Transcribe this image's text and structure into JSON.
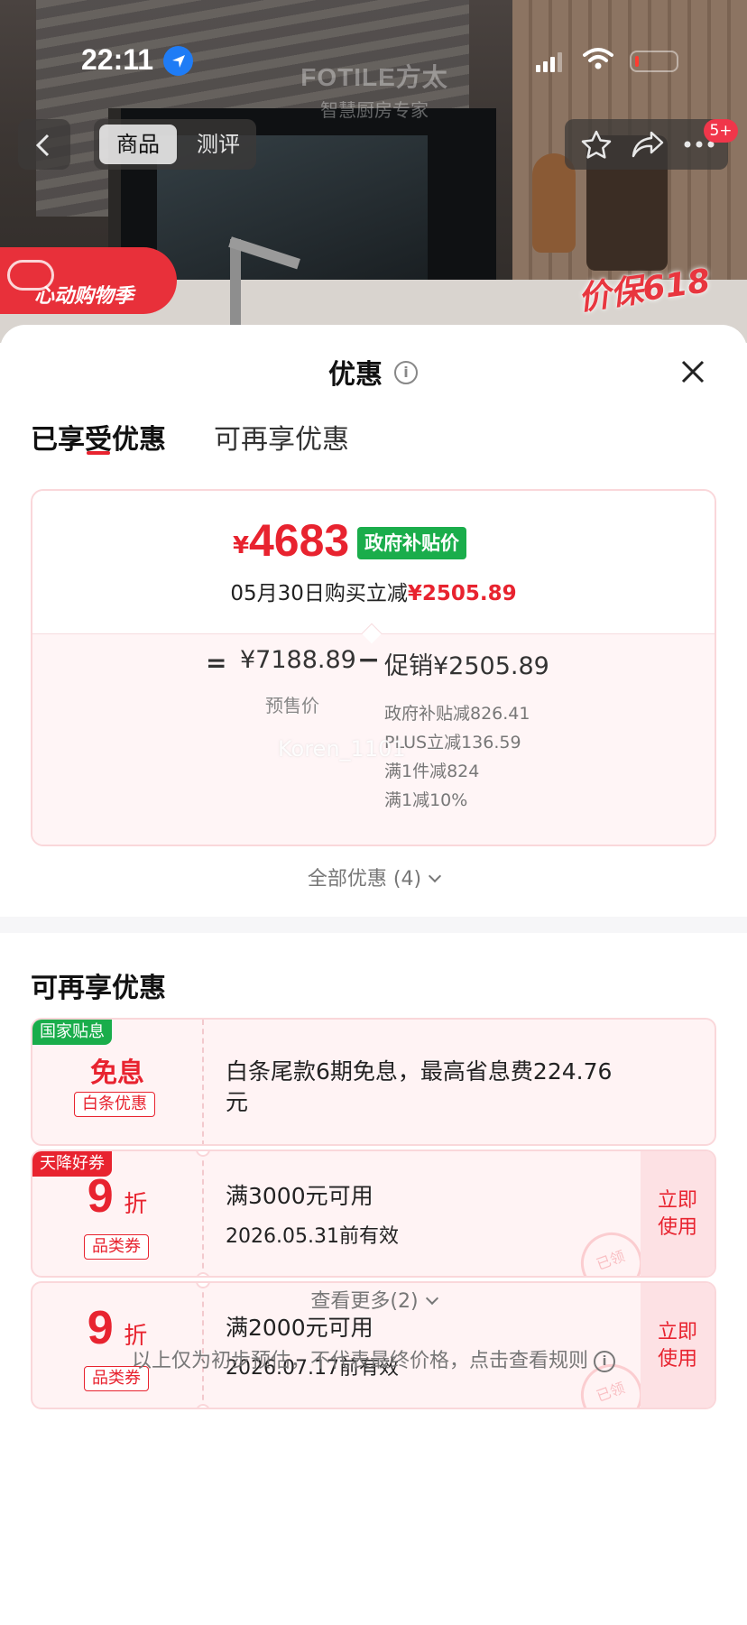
{
  "status_bar": {
    "time": "22:11"
  },
  "hero": {
    "brand_logo": "FOTILE方太",
    "brand_slogan": "智慧厨房专家",
    "tabs": [
      "商品",
      "测评"
    ],
    "badge": "5+",
    "promo_left": "心动购物季",
    "promo_right": "价保618"
  },
  "sheet": {
    "title": "优惠",
    "tabs": {
      "enjoyed": "已享受优惠",
      "more": "可再享优惠"
    },
    "calc": {
      "price_yen": "¥",
      "price_value": "4683",
      "price_tag": "政府补贴价",
      "subtitle_prefix": "05月30日购买立减",
      "subtitle_amount": "¥2505.89",
      "equals": "=",
      "presale_price": "¥7188.89",
      "presale_label": "预售价",
      "minus": "−",
      "promo_total": "促销¥2505.89",
      "promo_items": [
        "政府补贴减826.41",
        "PLUS立减136.59",
        "满1件减824",
        "满1减10%"
      ],
      "watermark": "Koren_1101"
    },
    "all_discounts": "全部优惠 (4)",
    "section2_title": "可再享优惠",
    "coupons": [
      {
        "corner_tag": "国家贴息",
        "corner_color": "#1aad4b",
        "big_text": "免息",
        "tag": "白条优惠",
        "desc1": "白条尾款6期免息，最高省息费224.76",
        "desc2": "元"
      },
      {
        "corner_tag": "天降好券",
        "corner_color": "#e8232f",
        "big_number": "9",
        "big_unit": "折",
        "tag": "品类券",
        "desc1": "满3000元可用",
        "desc2": "2026.05.31前有效",
        "use_label_1": "立即",
        "use_label_2": "使用",
        "stamp": "已领"
      },
      {
        "big_number": "9",
        "big_unit": "折",
        "tag": "品类券",
        "desc1": "满2000元可用",
        "desc2": "2026.07.17前有效",
        "use_label_1": "立即",
        "use_label_2": "使用",
        "stamp": "已领"
      }
    ],
    "see_more": "查看更多(2)",
    "disclaimer": "以上仅为初步预估，不代表最终价格，点击查看规则"
  },
  "colors": {
    "accent_red": "#e8232f",
    "gov_green": "#1aad4b",
    "card_border": "#fad7da"
  }
}
